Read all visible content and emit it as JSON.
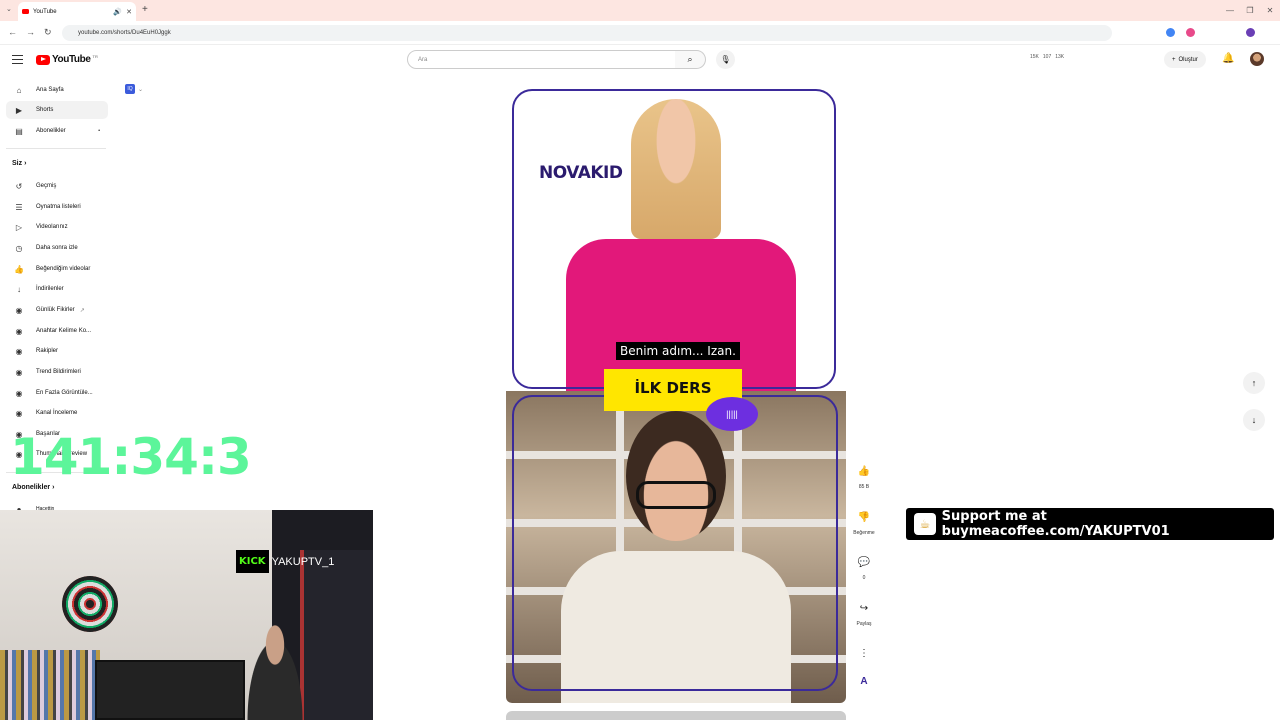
{
  "browser": {
    "tab_title": "YouTube",
    "url": "youtube.com/shorts/Du4EuH0Jggk"
  },
  "header": {
    "logo_text": "YouTube",
    "logo_country": "TR",
    "search_placeholder": "Ara",
    "stats": [
      "15K",
      "107",
      "13K"
    ],
    "create_label": "Oluştur"
  },
  "sidebar": {
    "items": [
      {
        "label": "Ana Sayfa",
        "icon": "home-icon"
      },
      {
        "label": "Shorts",
        "icon": "shorts-icon"
      },
      {
        "label": "Abonelikler",
        "icon": "subscriptions-icon"
      }
    ],
    "you_heading": "Siz",
    "you_items": [
      {
        "label": "Geçmiş",
        "icon": "history-icon"
      },
      {
        "label": "Oynatma listeleri",
        "icon": "playlist-icon"
      },
      {
        "label": "Videolarınız",
        "icon": "video-icon"
      },
      {
        "label": "Daha sonra izle",
        "icon": "clock-icon"
      },
      {
        "label": "Beğendiğim videolar",
        "icon": "like-icon"
      },
      {
        "label": "İndirilenler",
        "icon": "download-icon"
      },
      {
        "label": "Günlük Fikirler",
        "icon": "extension-icon"
      },
      {
        "label": "Anahtar Kelime Ko...",
        "icon": "extension-icon"
      },
      {
        "label": "Rakipler",
        "icon": "extension-icon"
      },
      {
        "label": "Trend Bildirimleri",
        "icon": "extension-icon"
      },
      {
        "label": "En Fazla Görüntüle...",
        "icon": "extension-icon"
      },
      {
        "label": "Kanal İnceleme",
        "icon": "extension-icon"
      },
      {
        "label": "Başarılar",
        "icon": "extension-icon"
      },
      {
        "label": "Thumbnail Preview",
        "icon": "extension-icon"
      }
    ],
    "subs_heading": "Abonelikler",
    "subs_partial": "Hacettin"
  },
  "overlay": {
    "timer": "141:34:3",
    "kick_badge": "KICK",
    "kick_name": "YAKUPTV_1",
    "support_text": "Support me at buymeacoffee.com/YAKUPTV01"
  },
  "short": {
    "brand": "NOVAKID",
    "subtitle": "Benim adım... Izan.",
    "banner": "İLK DERS"
  },
  "actions": {
    "like_count": "85 B",
    "dislike_label": "Beğenme",
    "comment_count": "0",
    "share_label": "Paylaş"
  }
}
